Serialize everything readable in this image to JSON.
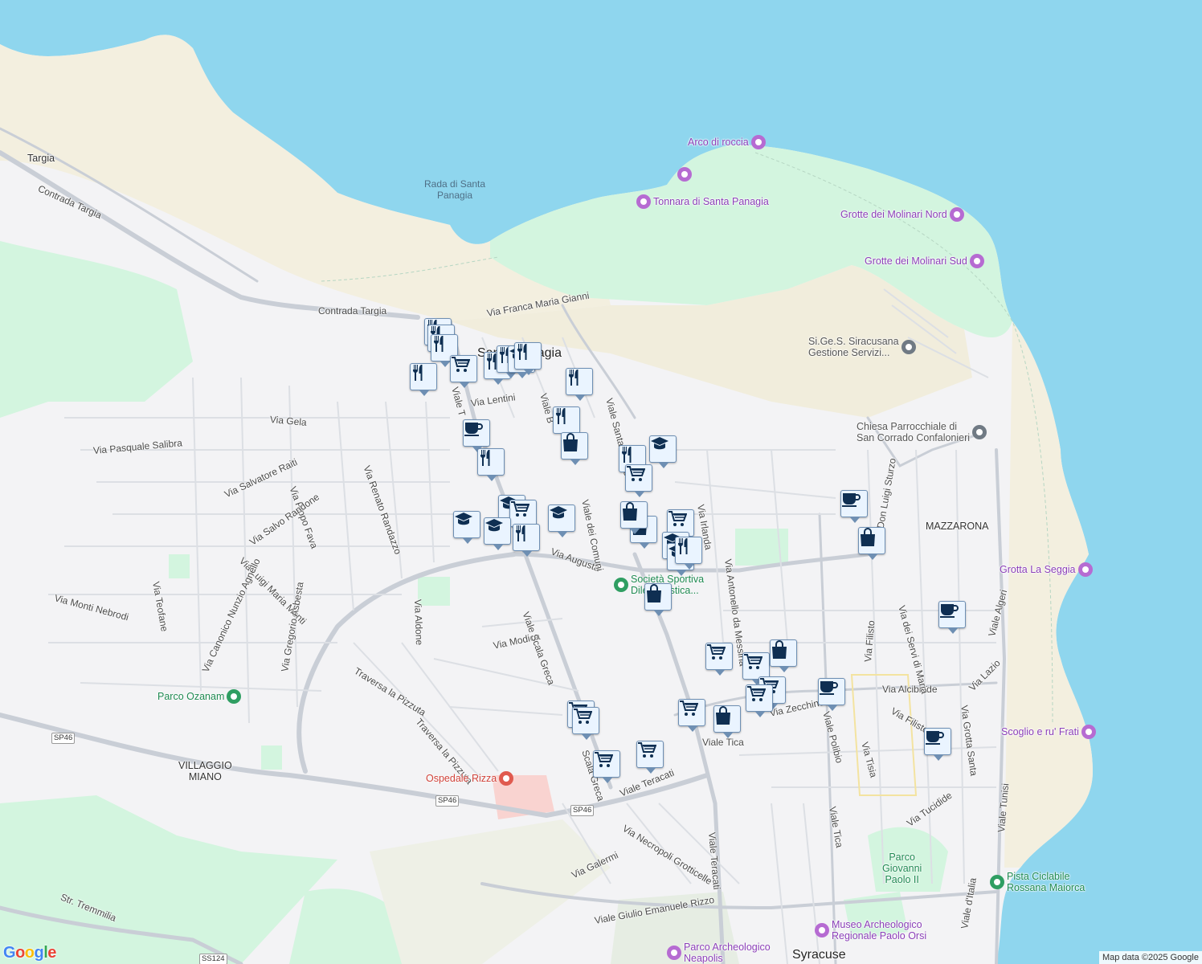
{
  "map": {
    "colors": {
      "water": "#8fd6ee",
      "land": "#f3f3f5",
      "park": "#d3f5df",
      "sand": "#f3efdf",
      "road": "#c9ced6",
      "marker_bg": "#eaf4ff",
      "marker_icon": "#0f2f52"
    },
    "water_labels": [
      {
        "id": "rada",
        "text": "Rada di Santa\nPanagia"
      }
    ],
    "place_labels": [
      {
        "id": "targia",
        "text": "Targia"
      },
      {
        "id": "villaggio-miano",
        "text": "VILLAGGIO\nMIANO"
      },
      {
        "id": "mazzarona",
        "text": "MAZZARONA"
      },
      {
        "id": "santa-panagia",
        "text": "Santa Panagia"
      },
      {
        "id": "syracuse",
        "text": "Syracuse"
      }
    ],
    "street_labels": [
      {
        "id": "contrada-targia-1",
        "text": "Contrada Targia"
      },
      {
        "id": "contrada-targia-2",
        "text": "Contrada Targia"
      },
      {
        "id": "via-franca-maria-gianni",
        "text": "Via Franca Maria Gianni"
      },
      {
        "id": "via-gela",
        "text": "Via Gela"
      },
      {
        "id": "via-pasquale-salibra",
        "text": "Via Pasquale Salibra"
      },
      {
        "id": "via-salvatore-raiti",
        "text": "Via Salvatore Raiti"
      },
      {
        "id": "via-pippo-fava",
        "text": "Via Pippo Fava"
      },
      {
        "id": "via-salvo-randone",
        "text": "Via Salvo Randone"
      },
      {
        "id": "via-luigi-maria-monti",
        "text": "Via Luigi Maria Monti"
      },
      {
        "id": "via-renato-randazzo",
        "text": "Via Renato Randazzo"
      },
      {
        "id": "via-teofane",
        "text": "Via Teofane"
      },
      {
        "id": "via-monti-nebrodi",
        "text": "Via Monti Nebrodi"
      },
      {
        "id": "via-canonico",
        "text": "Via Canonico Nunzio Agnello"
      },
      {
        "id": "via-gregorio-asbesta",
        "text": "Via Gregorio Asbesta"
      },
      {
        "id": "via-aldone",
        "text": "Via Aldone"
      },
      {
        "id": "traversa-pizzuta-1",
        "text": "Traversa la Pizzuta"
      },
      {
        "id": "traversa-pizzuta-2",
        "text": "Traversa la Pizzuta"
      },
      {
        "id": "via-modica",
        "text": "Via Modica"
      },
      {
        "id": "viale-scala-greca",
        "text": "Viale Scala Greca"
      },
      {
        "id": "via-augusta",
        "text": "Via Augusta"
      },
      {
        "id": "viale-dei-comuni",
        "text": "Viale dei Comuni"
      },
      {
        "id": "viale-santa-panagia",
        "text": "Viale Santa Panagia"
      },
      {
        "id": "via-lentini",
        "text": "Via Lentini"
      },
      {
        "id": "viale-b",
        "text": "Viale B"
      },
      {
        "id": "viale-t",
        "text": "Viale T"
      },
      {
        "id": "via-irlanda",
        "text": "Via Irlanda"
      },
      {
        "id": "via-antonello",
        "text": "Via Antonello da Messina"
      },
      {
        "id": "via-don-luigi-sturzo",
        "text": "Via Don Luigi Sturzo"
      },
      {
        "id": "viale-tica-1",
        "text": "Viale Tica"
      },
      {
        "id": "viale-tica-2",
        "text": "Viale Tica"
      },
      {
        "id": "via-zecchino",
        "text": "Via Zecchino"
      },
      {
        "id": "viale-polibio",
        "text": "Viale Polibio"
      },
      {
        "id": "via-filisto-1",
        "text": "Via Filisto"
      },
      {
        "id": "via-filisto-2",
        "text": "Via Filisto"
      },
      {
        "id": "via-alcibiade",
        "text": "Via Alcibiade"
      },
      {
        "id": "via-tisia",
        "text": "Via Tisia"
      },
      {
        "id": "via-dei-servi-di-maria",
        "text": "Via dei Servi di Maria"
      },
      {
        "id": "via-grotta-santa",
        "text": "Via Grotta Santa"
      },
      {
        "id": "via-lazio",
        "text": "Via Lazio"
      },
      {
        "id": "viale-algeri",
        "text": "Viale Algeri"
      },
      {
        "id": "via-tucidide",
        "text": "Via Tucidide"
      },
      {
        "id": "viale-tunisi",
        "text": "Viale Tunisi"
      },
      {
        "id": "viale-teracati-1",
        "text": "Viale Teracati"
      },
      {
        "id": "viale-teracati-2",
        "text": "Viale Teracati"
      },
      {
        "id": "via-necropoli",
        "text": "Via Necropoli Grotticelle"
      },
      {
        "id": "via-galermi",
        "text": "Via Galermi"
      },
      {
        "id": "viale-giulio-emanuele-rizzo",
        "text": "Viale Giulio Emanuele Rizzo"
      },
      {
        "id": "str-tremmilia",
        "text": "Str. Tremmilia"
      },
      {
        "id": "scala-greca-2",
        "text": "Scala Greca"
      },
      {
        "id": "viale-italia",
        "text": "Viale d'Italia"
      }
    ],
    "road_shields": [
      {
        "id": "sp46-1",
        "text": "SP46"
      },
      {
        "id": "sp46-2",
        "text": "SP46"
      },
      {
        "id": "sp46-3",
        "text": "SP46"
      },
      {
        "id": "ss124",
        "text": "SS124"
      }
    ],
    "pois": [
      {
        "id": "arco-di-roccia",
        "text": "Arco di roccia",
        "kind": "purple",
        "icon": "camera-icon"
      },
      {
        "id": "tonnara",
        "text": "Tonnara di Santa Panagia",
        "kind": "purple",
        "icon": "camera-icon"
      },
      {
        "id": "unnamed-camera",
        "text": "",
        "kind": "purple",
        "icon": "camera-icon"
      },
      {
        "id": "molinari-nord",
        "text": "Grotte dei Molinari Nord",
        "kind": "purple",
        "icon": "camera-icon"
      },
      {
        "id": "molinari-sud",
        "text": "Grotte dei Molinari Sud",
        "kind": "purple",
        "icon": "camera-icon"
      },
      {
        "id": "sigess",
        "text": "Si.Ge.S. Siracusana\nGestione Servizi...",
        "kind": "gray",
        "icon": "pin-icon"
      },
      {
        "id": "chiesa",
        "text": "Chiesa Parrocchiale di\nSan Corrado Confalonieri",
        "kind": "gray",
        "icon": "cross-icon"
      },
      {
        "id": "grotta-seggia",
        "text": "Grotta La Seggia",
        "kind": "purple",
        "icon": "camera-icon"
      },
      {
        "id": "scoglio",
        "text": "Scoglio e ru' Frati",
        "kind": "purple",
        "icon": "camera-icon"
      },
      {
        "id": "parco-ozanam",
        "text": "Parco Ozanam",
        "kind": "green",
        "icon": "tree-icon"
      },
      {
        "id": "ospedale-rizza",
        "text": "Ospedale Rizza",
        "kind": "red",
        "icon": "hospital-icon"
      },
      {
        "id": "societa-sportiva",
        "text": "Società Sportiva\nDilettantistica...",
        "kind": "green",
        "icon": "pin-icon"
      },
      {
        "id": "parco-giovanni",
        "text": "Parco\nGiovanni\nPaolo II",
        "kind": "green",
        "icon": "tree-icon"
      },
      {
        "id": "pista-ciclabile",
        "text": "Pista Ciclabile\nRossana Maiorca",
        "kind": "green",
        "icon": "pin-icon"
      },
      {
        "id": "museo",
        "text": "Museo Archeologico\nRegionale Paolo Orsi",
        "kind": "purple",
        "icon": "museum-icon"
      },
      {
        "id": "parco-archeologico",
        "text": "Parco Archeologico\nNeapolis",
        "kind": "purple",
        "icon": "monument-icon"
      }
    ],
    "markers": [
      {
        "type": "restaurant",
        "icon": "restaurant-icon"
      },
      {
        "type": "restaurant",
        "icon": "restaurant-icon"
      },
      {
        "type": "restaurant",
        "icon": "restaurant-icon"
      },
      {
        "type": "restaurant",
        "icon": "restaurant-icon"
      },
      {
        "type": "grocery",
        "icon": "cart-icon"
      },
      {
        "type": "restaurant",
        "icon": "restaurant-icon"
      },
      {
        "type": "restaurant",
        "icon": "restaurant-icon"
      },
      {
        "type": "school",
        "icon": "school-icon"
      },
      {
        "type": "restaurant",
        "icon": "restaurant-icon"
      },
      {
        "type": "restaurant",
        "icon": "restaurant-icon"
      },
      {
        "type": "restaurant",
        "icon": "restaurant-icon"
      },
      {
        "type": "cafe",
        "icon": "coffee-icon"
      },
      {
        "type": "restaurant",
        "icon": "restaurant-icon"
      },
      {
        "type": "shopping",
        "icon": "shopping-bag-icon"
      },
      {
        "type": "restaurant",
        "icon": "restaurant-icon"
      },
      {
        "type": "school",
        "icon": "school-icon"
      },
      {
        "type": "grocery",
        "icon": "cart-icon"
      },
      {
        "type": "school",
        "icon": "school-icon"
      },
      {
        "type": "grocery",
        "icon": "cart-icon"
      },
      {
        "type": "school",
        "icon": "school-icon"
      },
      {
        "type": "school",
        "icon": "school-icon"
      },
      {
        "type": "restaurant",
        "icon": "restaurant-icon"
      },
      {
        "type": "school",
        "icon": "school-icon"
      },
      {
        "type": "shopping",
        "icon": "shopping-bag-icon"
      },
      {
        "type": "shopping",
        "icon": "shopping-bag-icon"
      },
      {
        "type": "grocery",
        "icon": "cart-icon"
      },
      {
        "type": "school",
        "icon": "school-icon"
      },
      {
        "type": "school",
        "icon": "school-icon"
      },
      {
        "type": "restaurant",
        "icon": "restaurant-icon"
      },
      {
        "type": "shopping",
        "icon": "shopping-bag-icon"
      },
      {
        "type": "cafe",
        "icon": "coffee-icon"
      },
      {
        "type": "shopping",
        "icon": "shopping-bag-icon"
      },
      {
        "type": "cafe",
        "icon": "coffee-icon"
      },
      {
        "type": "grocery",
        "icon": "cart-icon"
      },
      {
        "type": "grocery",
        "icon": "cart-icon"
      },
      {
        "type": "shopping",
        "icon": "shopping-bag-icon"
      },
      {
        "type": "grocery",
        "icon": "cart-icon"
      },
      {
        "type": "grocery",
        "icon": "cart-icon"
      },
      {
        "type": "cafe",
        "icon": "coffee-icon"
      },
      {
        "type": "grocery",
        "icon": "cart-icon"
      },
      {
        "type": "shopping",
        "icon": "shopping-bag-icon"
      },
      {
        "type": "grocery",
        "icon": "cart-icon"
      },
      {
        "type": "grocery",
        "icon": "cart-icon"
      },
      {
        "type": "grocery",
        "icon": "cart-icon"
      },
      {
        "type": "grocery",
        "icon": "cart-icon"
      },
      {
        "type": "cafe",
        "icon": "coffee-icon"
      }
    ],
    "attribution": "Map data ©2025 Google",
    "logo": "Google"
  }
}
